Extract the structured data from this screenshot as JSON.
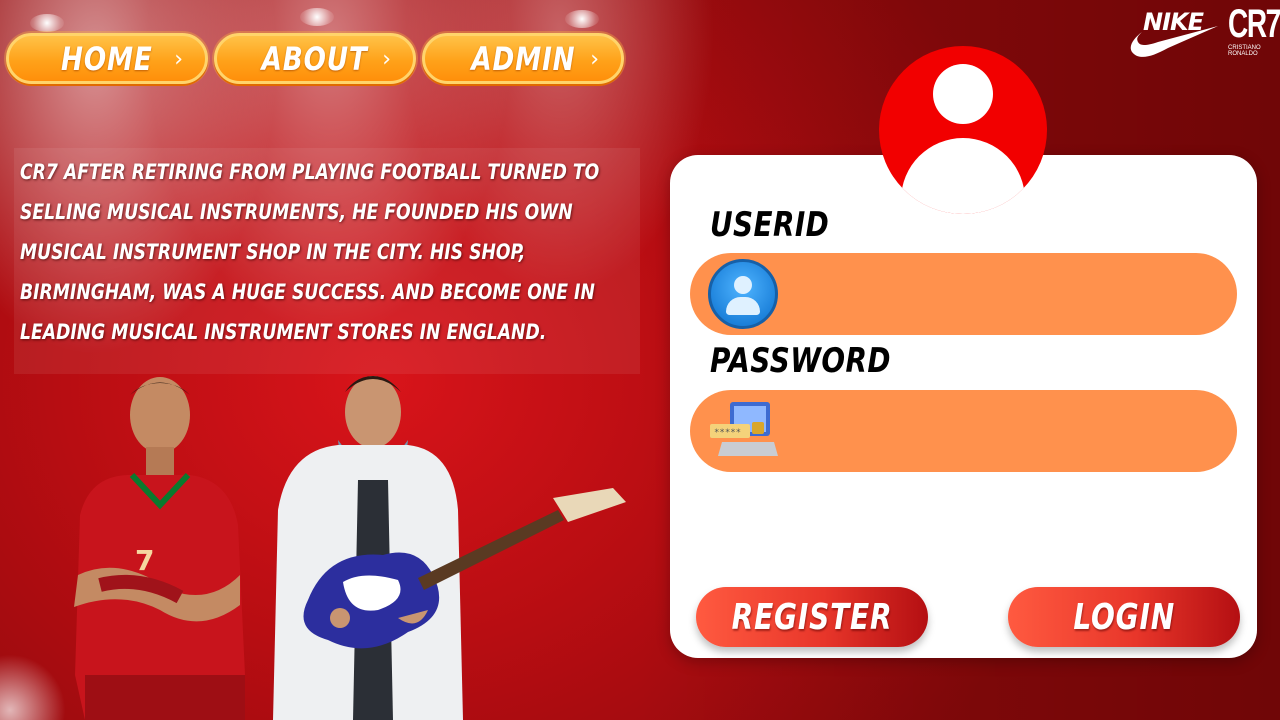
{
  "nav": {
    "items": [
      {
        "label": "HOME"
      },
      {
        "label": "ABOUT"
      },
      {
        "label": "ADMIN"
      }
    ],
    "chevron": "›"
  },
  "story": {
    "text": "CR7 after retiring from playing football turned to selling musical instruments, he founded his own musical instrument shop in the city. His shop, Birmingham, was a huge success. And become one in leading musical instrument stores in England."
  },
  "brand": {
    "nike": "NIKE",
    "cr7": "CR7",
    "cr7_sub": "CRISTIANO RONALDO"
  },
  "login": {
    "userid_label": "USERID",
    "password_label": "PASSWORD",
    "userid_value": "",
    "password_value": "",
    "register_label": "REGISTER",
    "login_label": "LOGIN",
    "icons": [
      "user-avatar-icon",
      "userid-person-icon",
      "password-laptop-icon"
    ]
  },
  "colors": {
    "accent_red": "#f20000",
    "field_orange": "#ff914d",
    "nav_orange": "#ffa21a",
    "button_red": "#e8362a"
  }
}
